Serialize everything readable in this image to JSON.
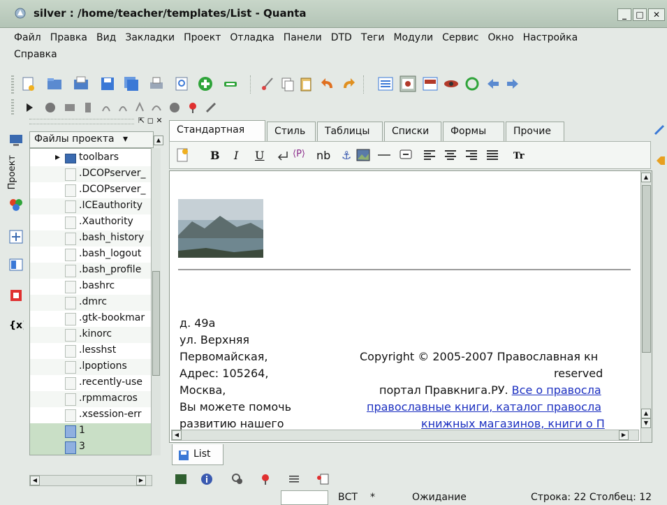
{
  "window": {
    "title": "silver : /home/teacher/templates/List - Quanta",
    "minimize_label": "_",
    "maximize_label": "□",
    "close_label": "✕"
  },
  "menu": {
    "row1": [
      "Файл",
      "Правка",
      "Вид",
      "Закладки",
      "Проект",
      "Отладка",
      "Панели",
      "DTD",
      "Теги",
      "Модули",
      "Сервис",
      "Окно",
      "Настройка"
    ],
    "row2": [
      "Справка"
    ]
  },
  "left_strip": {
    "project_label": "Проект",
    "icons": [
      "monitor-icon",
      "project-tree-icon",
      "templates-icon",
      "structure-icon",
      "plugin-icon",
      "variables-icon"
    ]
  },
  "project_panel": {
    "header": "Файлы проекта",
    "header_arrow": "▾",
    "panel_controls": "⇱ ◻ ✕",
    "files": [
      {
        "name": "toolbars",
        "type": "folder"
      },
      {
        "name": ".DCOPserver_",
        "type": "file"
      },
      {
        "name": ".DCOPserver_",
        "type": "file"
      },
      {
        "name": ".ICEauthority",
        "type": "file"
      },
      {
        "name": ".Xauthority",
        "type": "file"
      },
      {
        "name": ".bash_history",
        "type": "file"
      },
      {
        "name": ".bash_logout",
        "type": "file"
      },
      {
        "name": ".bash_profile",
        "type": "file"
      },
      {
        "name": ".bashrc",
        "type": "file"
      },
      {
        "name": ".dmrc",
        "type": "file"
      },
      {
        "name": ".gtk-bookmar",
        "type": "file"
      },
      {
        "name": ".kinorc",
        "type": "file"
      },
      {
        "name": ".lesshst",
        "type": "file"
      },
      {
        "name": ".lpoptions",
        "type": "file"
      },
      {
        "name": ".recently-use",
        "type": "file"
      },
      {
        "name": ".rpmmacros",
        "type": "file"
      },
      {
        "name": ".xsession-err",
        "type": "file"
      },
      {
        "name": "1",
        "type": "web"
      },
      {
        "name": "3",
        "type": "web"
      }
    ]
  },
  "editor_tabs": [
    "Стандартная",
    "Стиль",
    "Таблицы",
    "Списки",
    "Формы",
    "Прочие"
  ],
  "format_toolbar": {
    "bold": "B",
    "italic": "I",
    "underline": "U",
    "paragraph": "⟨P⟩",
    "nbsp": "nb",
    "anchor": "⚓"
  },
  "editor": {
    "address_lines": [
      "д. 49а",
      "ул. Верхняя",
      "Первомайская,",
      "Адрес: 105264,",
      "Москва,",
      "Вы можете помочь",
      "развитию нашего"
    ],
    "copyright_line": "Copyright © 2005-2007 Православная кн",
    "reserved": "reserved",
    "portal_prefix": "портал Правкнига.РУ.",
    "portal_link": "Все о правосла",
    "link_line2": "православные книги, каталог правосла",
    "link_line3": "книжных магазинов, книги о П"
  },
  "doc_tab": {
    "label": "List"
  },
  "status": {
    "mode": "ВСТ",
    "modified": "*",
    "state": "Ожидание",
    "position": "Строка: 22 Столбец: 12"
  },
  "colors": {
    "titlebar": "#b3c4b6",
    "link": "#1a2ec0",
    "chrome": "#e4e9e5"
  }
}
